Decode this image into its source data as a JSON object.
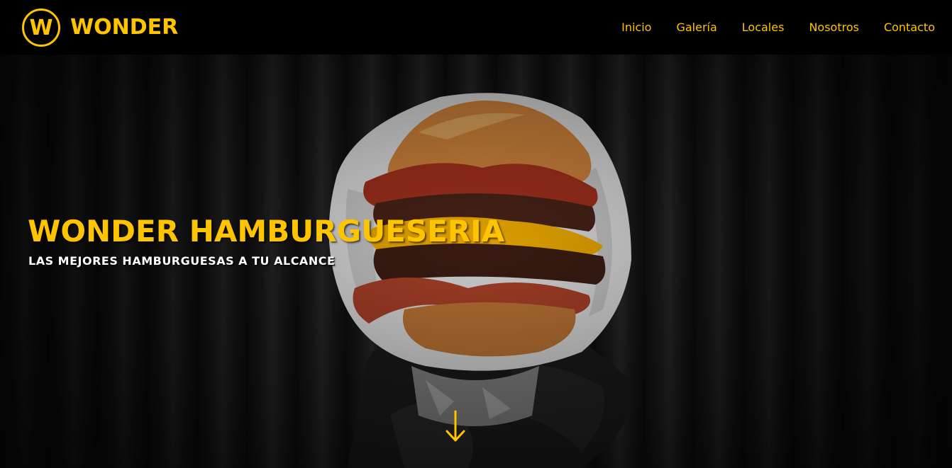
{
  "brand": {
    "logo_letter": "W",
    "name": "WONDER"
  },
  "nav": {
    "items": [
      {
        "label": "Inicio"
      },
      {
        "label": "Galería"
      },
      {
        "label": "Locales"
      },
      {
        "label": "Nosotros"
      },
      {
        "label": "Contacto"
      }
    ]
  },
  "hero": {
    "title": "WONDER HAMBURGUESERIA",
    "subtitle": "LAS MEJORES HAMBURGUESAS A TU ALCANCE",
    "scroll_icon": "arrow-down-icon"
  },
  "colors": {
    "accent": "#FFC400",
    "background": "#000000",
    "text_light": "#FFFFFF"
  }
}
